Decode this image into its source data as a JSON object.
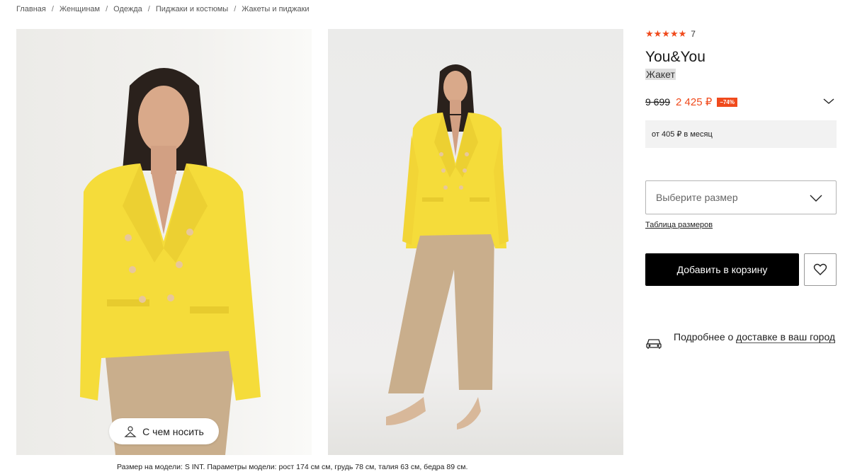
{
  "breadcrumbs": [
    "Главная",
    "Женщинам",
    "Одежда",
    "Пиджаки и костюмы",
    "Жакеты и пиджаки"
  ],
  "breadcrumb_separator": "/",
  "gallery": {
    "wear_button_label": "С чем носить",
    "model_params": "Размер на модели: S INT. Параметры модели: рост 174 см см, грудь 78 см, талия 63 см, бедра 89 см."
  },
  "product": {
    "rating_stars": "★★★★★",
    "rating_value": 5,
    "rating_count": "7",
    "brand": "You&You",
    "type": "Жакет",
    "old_price": "9 699",
    "new_price": "2 425 ₽",
    "discount": "−74%",
    "installment": "от 405 ₽ в месяц",
    "size_placeholder": "Выберите размер",
    "size_table_link": "Таблица размеров",
    "add_to_cart": "Добавить в корзину",
    "delivery_text_1": "Подробнее о ",
    "delivery_link": "доставке в ваш город"
  },
  "colors": {
    "accent": "#f04a1c",
    "jacket": "#f5dc3a",
    "trousers": "#c9ae8c",
    "button_dark": "#000000"
  },
  "icons": [
    "person-hanger-icon",
    "chevron-down-icon",
    "heart-icon",
    "car-icon"
  ]
}
